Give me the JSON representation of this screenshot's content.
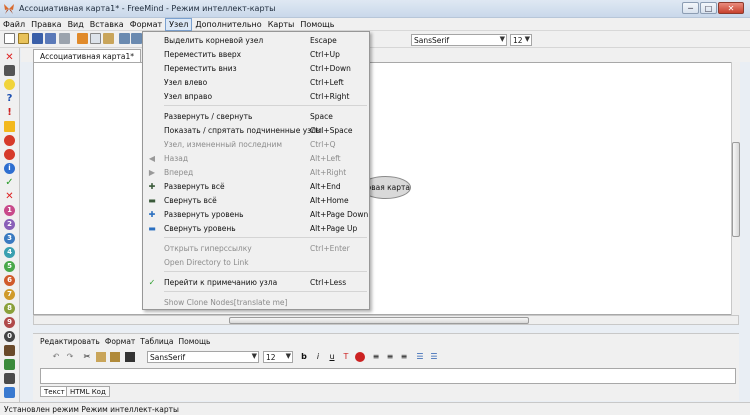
{
  "window": {
    "title": "Ассоциативная карта1* - FreeMind - Режим интеллект-карты",
    "controls": [
      "─",
      "□",
      "✕"
    ]
  },
  "menubar": {
    "items": [
      "Файл",
      "Правка",
      "Вид",
      "Вставка",
      "Формат",
      "Узел",
      "Дополнительно",
      "Карты",
      "Помощь"
    ],
    "active": "Узел"
  },
  "toolbar": {
    "font_name": "SansSerif",
    "font_size": "12"
  },
  "tab": {
    "label": "Ассоциативная карта1*"
  },
  "node": {
    "text": "Новая карта"
  },
  "node_menu": {
    "items": [
      {
        "label": "Выделить корневой узел",
        "shortcut": "Escape",
        "disabled": false,
        "icon": ""
      },
      {
        "label": "Переместить вверх",
        "shortcut": "Ctrl+Up",
        "disabled": false,
        "icon": ""
      },
      {
        "label": "Переместить вниз",
        "shortcut": "Ctrl+Down",
        "disabled": false,
        "icon": ""
      },
      {
        "label": "Узел влево",
        "shortcut": "Ctrl+Left",
        "disabled": false,
        "icon": ""
      },
      {
        "label": "Узел вправо",
        "shortcut": "Ctrl+Right",
        "disabled": false,
        "icon": ""
      },
      {
        "label": "Развернуть / свернуть",
        "shortcut": "Space",
        "disabled": false,
        "icon": ""
      },
      {
        "label": "Показать / спрятать подчиненные  узлы",
        "shortcut": "Ctrl+Space",
        "disabled": false,
        "icon": ""
      },
      {
        "label": "Узел, измененный последним",
        "shortcut": "Ctrl+Q",
        "disabled": true,
        "icon": ""
      },
      {
        "label": "Назад",
        "shortcut": "Alt+Left",
        "disabled": true,
        "icon": "arrow-left-icon"
      },
      {
        "label": "Вперед",
        "shortcut": "Alt+Right",
        "disabled": true,
        "icon": "arrow-right-icon"
      },
      {
        "label": "Развернуть всё",
        "shortcut": "Alt+End",
        "disabled": false,
        "icon": "expand-all-icon"
      },
      {
        "label": "Свернуть всё",
        "shortcut": "Alt+Home",
        "disabled": false,
        "icon": "collapse-all-icon"
      },
      {
        "label": "Развернуть уровень",
        "shortcut": "Alt+Page Down",
        "disabled": false,
        "icon": "expand-level-icon"
      },
      {
        "label": "Свернуть уровень",
        "shortcut": "Alt+Page Up",
        "disabled": false,
        "icon": "collapse-level-icon"
      },
      {
        "label": "Открыть гиперссылку",
        "shortcut": "Ctrl+Enter",
        "disabled": true,
        "icon": ""
      },
      {
        "label": "Open Directory to Link",
        "shortcut": "",
        "disabled": true,
        "icon": ""
      },
      {
        "label": "Перейти к примечанию узла",
        "shortcut": "Ctrl+Less",
        "disabled": false,
        "icon": "checkmark-icon"
      },
      {
        "label": "Show Clone Nodes[translate me]",
        "shortcut": "",
        "disabled": true,
        "icon": ""
      }
    ]
  },
  "editor": {
    "menu": [
      "Редактировать",
      "Формат",
      "Таблица",
      "Помощь"
    ],
    "font_name": "SansSerif",
    "font_size": "12",
    "tabs": [
      "Текст",
      "HTML Код"
    ]
  },
  "status": {
    "text": "Установлен режим Режим интеллект-карты"
  }
}
